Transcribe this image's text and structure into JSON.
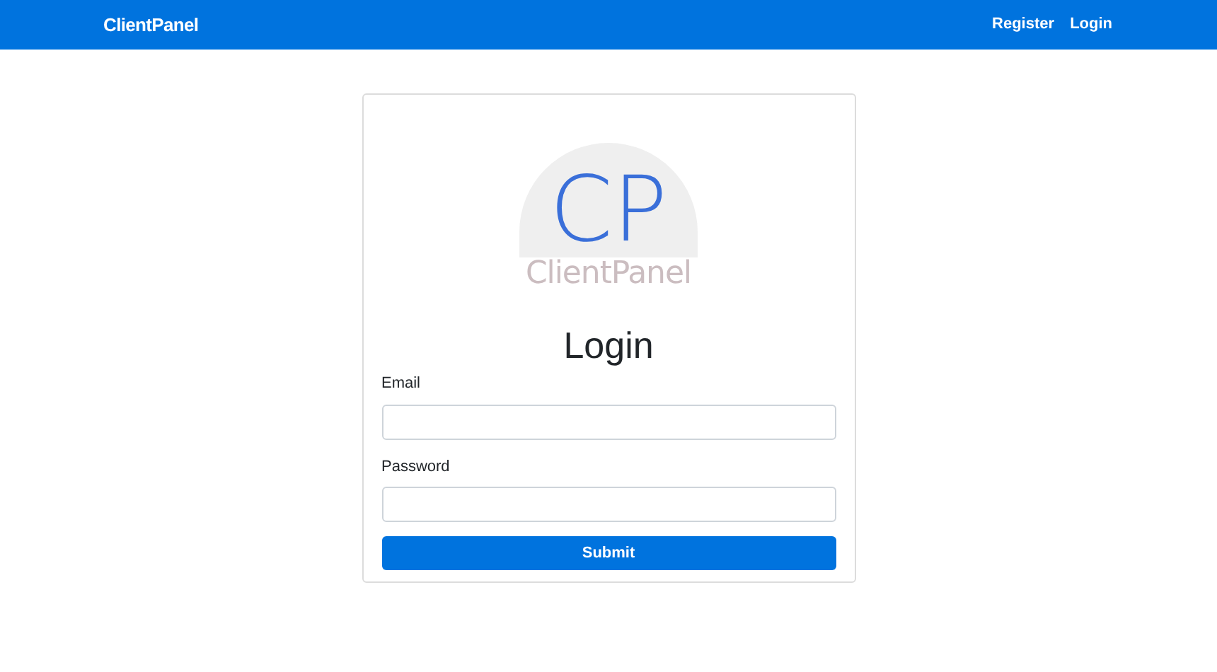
{
  "navbar": {
    "brand": "ClientPanel",
    "links": [
      "Register",
      "Login"
    ]
  },
  "logo": {
    "initials": "CP",
    "name": "ClientPanel"
  },
  "form": {
    "title": "Login",
    "fields": [
      {
        "label": "Email"
      },
      {
        "label": "Password"
      }
    ],
    "submit": "Submit"
  }
}
